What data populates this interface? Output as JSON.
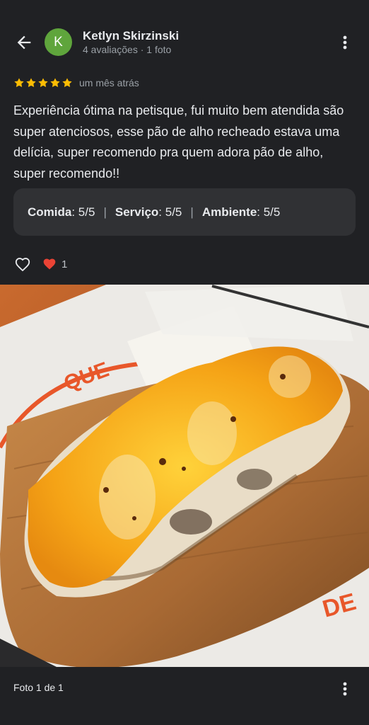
{
  "colors": {
    "background": "#202124",
    "avatar": "#5fa53c",
    "star": "#fbbc04",
    "heart": "#ea4335"
  },
  "header": {
    "avatar_initial": "K",
    "reviewer_name": "Ketlyn Skirzinski",
    "reviewer_meta": "4 avaliações · 1 foto",
    "back_icon": "arrow-back-icon",
    "more_icon": "more-vert-icon"
  },
  "review": {
    "stars": 5,
    "max_stars": 5,
    "time_ago": "um mês atrás",
    "text": "Experiência ótima na petisque, fui muito bem atendida são super atenciosos, esse pão de alho recheado estava uma delícia, super recomendo pra quem adora pão de alho, super recomendo!!"
  },
  "ratings": [
    {
      "label": "Comida",
      "value": ": 5/5"
    },
    {
      "label": "Serviço",
      "value": ": 5/5"
    },
    {
      "label": "Ambiente",
      "value": ": 5/5"
    }
  ],
  "actions": {
    "like_icon": "heart-outline-icon",
    "reaction_icon": "red-heart-icon",
    "reaction_count": "1"
  },
  "photo": {
    "description_icon": "food-photo"
  },
  "footer": {
    "photo_count": "Foto 1 de 1",
    "more_icon": "more-vert-icon"
  }
}
